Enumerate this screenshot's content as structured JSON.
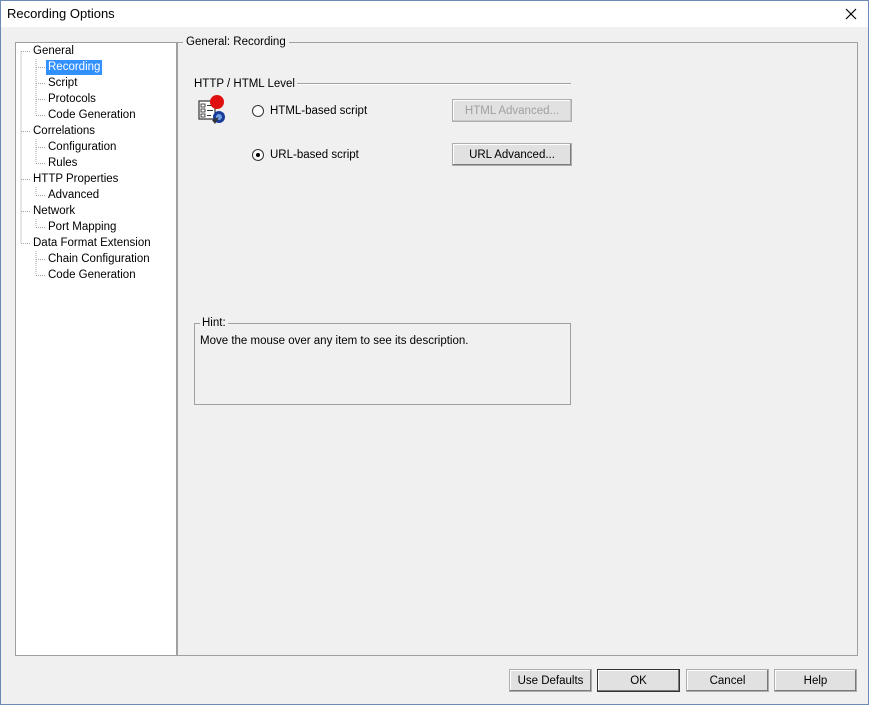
{
  "window": {
    "title": "Recording Options"
  },
  "tree": {
    "items": [
      {
        "label": "General",
        "level": 0,
        "selected": false
      },
      {
        "label": "Recording",
        "level": 1,
        "selected": true
      },
      {
        "label": "Script",
        "level": 1,
        "selected": false
      },
      {
        "label": "Protocols",
        "level": 1,
        "selected": false
      },
      {
        "label": "Code Generation",
        "level": 1,
        "selected": false
      },
      {
        "label": "Correlations",
        "level": 0,
        "selected": false
      },
      {
        "label": "Configuration",
        "level": 1,
        "selected": false
      },
      {
        "label": "Rules",
        "level": 1,
        "selected": false
      },
      {
        "label": "HTTP Properties",
        "level": 0,
        "selected": false
      },
      {
        "label": "Advanced",
        "level": 1,
        "selected": false
      },
      {
        "label": "Network",
        "level": 0,
        "selected": false
      },
      {
        "label": "Port Mapping",
        "level": 1,
        "selected": false
      },
      {
        "label": "Data Format Extension",
        "level": 0,
        "selected": false
      },
      {
        "label": "Chain Configuration",
        "level": 1,
        "selected": false
      },
      {
        "label": "Code Generation",
        "level": 1,
        "selected": false
      }
    ]
  },
  "panel": {
    "title": "General: Recording",
    "group_title": "HTTP / HTML Level",
    "html_radio": {
      "label": "HTML-based script",
      "checked": false
    },
    "url_radio": {
      "label": "URL-based script",
      "checked": true
    },
    "html_advanced_label": "HTML Advanced...",
    "url_advanced_label": "URL Advanced...",
    "hint": {
      "title": "Hint:",
      "text": "Move the mouse over any item to see its description."
    }
  },
  "footer": {
    "use_defaults_label": "Use Defaults",
    "ok_label": "OK",
    "cancel_label": "Cancel",
    "help_label": "Help"
  },
  "icons": {
    "close": "close-icon",
    "recording": "recording-settings-icon"
  },
  "colors": {
    "selection": "#3390ff",
    "dialog_bg": "#f0f0f0"
  }
}
